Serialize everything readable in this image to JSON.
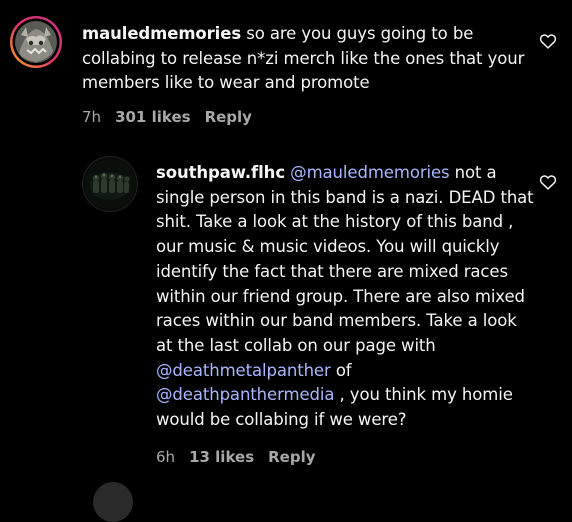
{
  "comments": [
    {
      "username": "mauledmemories",
      "text": "so are you guys going to be collabing to release n*zi merch like the ones that your members like to wear and promote",
      "time": "7h",
      "likes": "301 likes",
      "reply_label": "Reply",
      "like_icon": "heart-outline-icon"
    },
    {
      "username": "southpaw.flhc",
      "mention1": "@mauledmemories",
      "text_part1": " not a single person in this band is a nazi. DEAD that shit. Take a look at the history of this band , our music & music videos. You will quickly identify the fact that there are mixed races within our friend group. There are also mixed races within our band members. Take a look at the last collab on our page with ",
      "mention2": "@deathmetalpanther",
      "text_part2": " of ",
      "mention3": "@deathpanthermedia",
      "text_part3": " , you think my homie would be collabing if we were?",
      "time": "6h",
      "likes": "13 likes",
      "reply_label": "Reply",
      "like_icon": "heart-outline-icon"
    }
  ],
  "colors": {
    "background": "#000000",
    "text": "#f5f5f5",
    "mention": "#a9b6ff",
    "meta": "#a8a8a8"
  }
}
